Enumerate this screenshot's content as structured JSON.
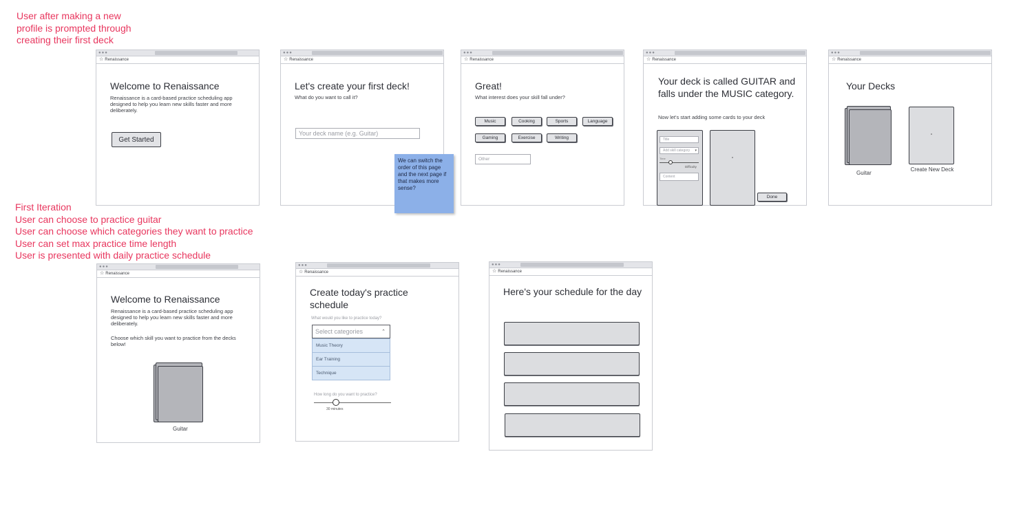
{
  "annotations": {
    "top_note": "User after making a new\nprofile is prompted through\ncreating their first deck",
    "iteration_note": "First Iteration\nUser can choose to practice guitar\nUser can choose which categories they want to practice\nUser can set max practice time length\nUser is presented with daily practice schedule",
    "sticky_note": "We can switch the order of this page and the next page if that makes more sense?"
  },
  "browser": {
    "tab_label": "Renaissance",
    "tab_icon": "star-icon"
  },
  "screen_welcome": {
    "title": "Welcome to Renaissance",
    "description": "Renaissance is a card-based practice scheduling app designed to help you learn new skills faster and more deliberately.",
    "button": "Get Started"
  },
  "screen_create_deck": {
    "title": "Let's create your first deck!",
    "subtitle": "What do you want to call it?",
    "input_placeholder": "Your deck name (e.g. Guitar)"
  },
  "screen_interest": {
    "title": "Great!",
    "subtitle": "What interest does your skill fall under?",
    "chips": [
      "Music",
      "Cooking",
      "Sports",
      "Language",
      "Gaming",
      "Exercise",
      "Writing"
    ],
    "other_placeholder": "Other"
  },
  "screen_add_cards": {
    "title": "Your deck is called GUITAR and falls under the MUSIC category.",
    "subtitle": "Now let's start adding some cards to your deck",
    "form_title_placeholder": "Title",
    "form_category_placeholder": "Add skill category",
    "form_slider_label": "Time",
    "form_difficulty_label": "Difficulty",
    "form_content_placeholder": "Content",
    "done_button": "Done"
  },
  "screen_your_decks": {
    "title": "Your Decks",
    "deck_label": "Guitar",
    "create_label": "Create New Deck"
  },
  "screen_welcome_v2": {
    "title": "Welcome to Renaissance",
    "description": "Renaissance is a card-based practice scheduling app designed to help you learn new skills faster and more deliberately.",
    "prompt": "Choose which skill you want to practice from the decks below!",
    "deck_label": "Guitar"
  },
  "screen_schedule_create": {
    "title": "Create today's practice schedule",
    "question": "What would you like to practice today?",
    "select_placeholder": "Select categories",
    "options": [
      "Music Theory",
      "Ear Training",
      "Technique"
    ],
    "time_question": "How long do you want to practice?",
    "time_value": "30 minutes"
  },
  "screen_schedule_view": {
    "title": "Here's your schedule for the day"
  }
}
